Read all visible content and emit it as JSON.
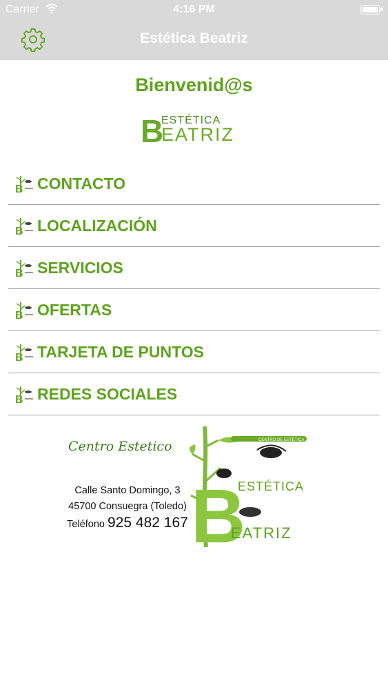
{
  "status_bar": {
    "carrier": "Carrier",
    "time": "4:16 PM"
  },
  "nav": {
    "title": "Estética Beatriz",
    "settings_icon": "gear-icon"
  },
  "welcome": "Bienvenid@s",
  "brand": {
    "line1": "ESTÉTICA",
    "line2_initial": "B",
    "line2_rest": "EATRIZ"
  },
  "menu": [
    {
      "label": "CONTACTO"
    },
    {
      "label": "LOCALIZACIÓN"
    },
    {
      "label": "SERVICIOS"
    },
    {
      "label": "OFERTAS"
    },
    {
      "label": "TARJETA DE PUNTOS"
    },
    {
      "label": "REDES SOCIALES"
    }
  ],
  "banner": {
    "centro": "Centro Estetico",
    "address_line1": "Calle Santo Domingo, 3",
    "address_line2": "45700 Consuegra (Toledo)",
    "phone_label": "Teléfono",
    "phone_number": "925 482 167",
    "tag": "CENTRO DE ESTÉTICA"
  },
  "colors": {
    "accent": "#5ea21e",
    "bar": "#d9d9d9",
    "divider": "#9d9d9d"
  }
}
